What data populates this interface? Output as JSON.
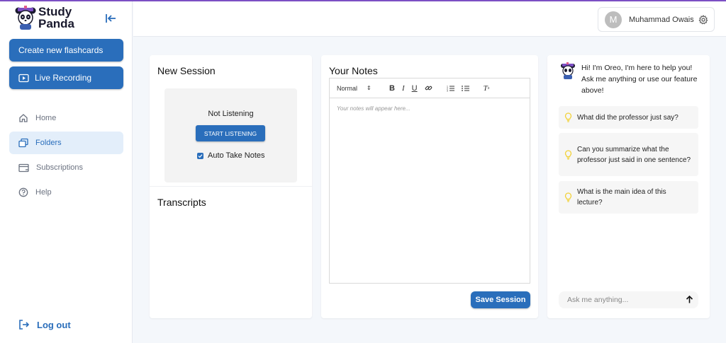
{
  "app": {
    "logo_line1": "Study",
    "logo_line2": "Panda"
  },
  "sidebar": {
    "create_flashcards": "Create new flashcards",
    "live_recording": "Live Recording",
    "items": [
      {
        "label": "Home",
        "icon": "home-icon"
      },
      {
        "label": "Folders",
        "icon": "folders-icon",
        "active": true
      },
      {
        "label": "Subscriptions",
        "icon": "card-icon"
      },
      {
        "label": "Help",
        "icon": "help-icon"
      }
    ],
    "logout": "Log out"
  },
  "topbar": {
    "avatar_initial": "M",
    "user_name": "Muhammad Owais"
  },
  "session": {
    "title": "New Session",
    "status": "Not Listening",
    "start_button": "START LISTENING",
    "auto_take_notes": "Auto Take Notes",
    "auto_take_notes_checked": true,
    "transcripts_title": "Transcripts"
  },
  "notes": {
    "title": "Your Notes",
    "format_value": "Normal",
    "placeholder": "Your notes will appear here...",
    "save_button": "Save Session"
  },
  "chat": {
    "greeting": "Hi! I'm Oreo, I'm here to help you! Ask me anything or use our feature above!",
    "suggestions": [
      "What did the professor just say?",
      "Can you summarize what the professor just said in one sentence?",
      "What is the main idea of this lecture?"
    ],
    "input_placeholder": "Ask me anything..."
  },
  "colors": {
    "primary": "#2a6ebb",
    "accent_top": "#7c4fc4",
    "bulb": "#f2d23a"
  }
}
